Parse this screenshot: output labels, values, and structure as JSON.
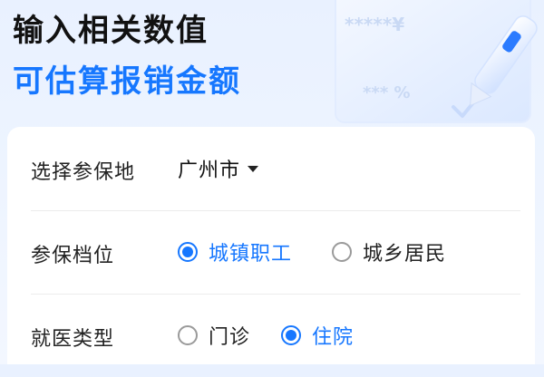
{
  "header": {
    "title_line1": "输入相关数值",
    "title_line2": "可估算报销金额",
    "deco_line1": "*****¥",
    "deco_line2": "*** %"
  },
  "form": {
    "location": {
      "label": "选择参保地",
      "value": "广州市"
    },
    "insurance_level": {
      "label": "参保档位",
      "options": [
        {
          "label": "城镇职工",
          "selected": true
        },
        {
          "label": "城乡居民",
          "selected": false
        }
      ]
    },
    "visit_type": {
      "label": "就医类型",
      "options": [
        {
          "label": "门诊",
          "selected": false
        },
        {
          "label": "住院",
          "selected": true
        }
      ]
    }
  },
  "colors": {
    "accent": "#1677ff",
    "title": "#111111",
    "background": "#edf4ff"
  },
  "icons": [
    "calculator-card-illustration",
    "pen-illustration",
    "dropdown-caret-icon",
    "radio-icon"
  ]
}
